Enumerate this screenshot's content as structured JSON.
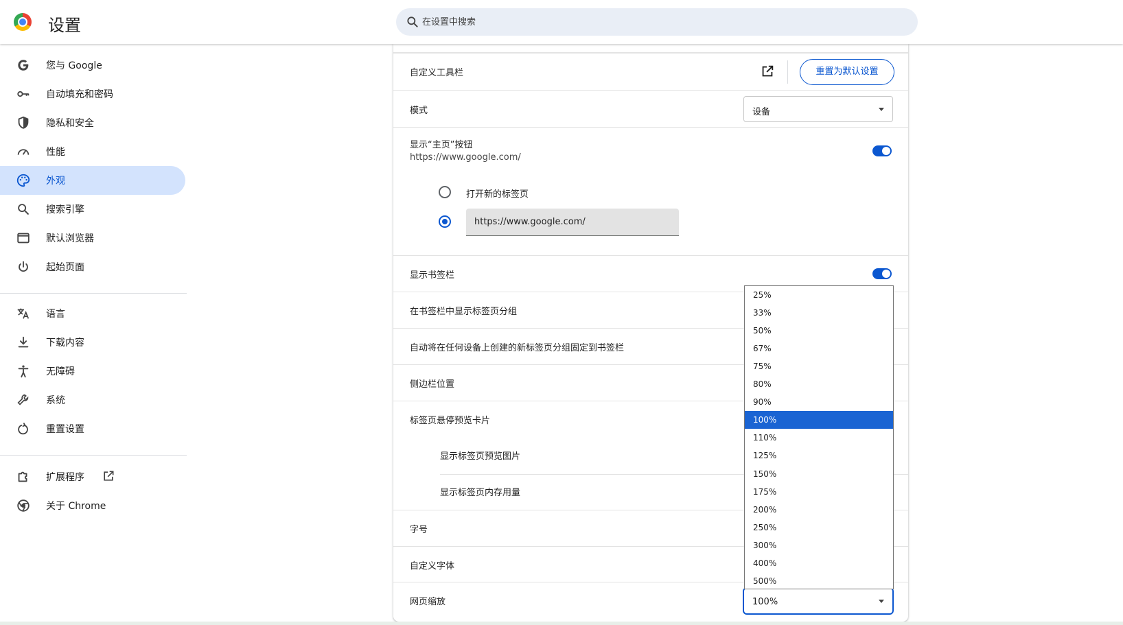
{
  "header": {
    "title": "设置",
    "search_placeholder": "在设置中搜索"
  },
  "sidebar": {
    "items": [
      {
        "label": "您与 Google",
        "icon": "google-g-icon"
      },
      {
        "label": "自动填充和密码",
        "icon": "key-icon"
      },
      {
        "label": "隐私和安全",
        "icon": "shield-icon"
      },
      {
        "label": "性能",
        "icon": "speedometer-icon"
      },
      {
        "label": "外观",
        "icon": "palette-icon",
        "active": true
      },
      {
        "label": "搜索引擎",
        "icon": "search-icon"
      },
      {
        "label": "默认浏览器",
        "icon": "browser-window-icon"
      },
      {
        "label": "起始页面",
        "icon": "power-icon"
      },
      {
        "label": "语言",
        "icon": "translate-icon"
      },
      {
        "label": "下载内容",
        "icon": "download-icon"
      },
      {
        "label": "无障碍",
        "icon": "accessibility-icon"
      },
      {
        "label": "系统",
        "icon": "wrench-icon"
      },
      {
        "label": "重置设置",
        "icon": "reset-icon"
      },
      {
        "label": "扩展程序",
        "icon": "puzzle-icon"
      },
      {
        "label": "关于 Chrome",
        "icon": "chrome-icon"
      }
    ]
  },
  "appearance": {
    "customize_toolbar": "自定义工具栏",
    "reset_button": "重置为默认设置",
    "mode_label": "模式",
    "mode_value": "设备",
    "home_button_label": "显示“主页”按钮",
    "home_button_sub": "https://www.google.com/",
    "home_button_on": true,
    "radio_new_tab": "打开新的标签页",
    "custom_url_value": "https://www.google.com/",
    "bookmarks_bar_label": "显示书签栏",
    "bookmarks_bar_on": true,
    "tab_groups_in_bookmarks": "在书签栏中显示标签页分组",
    "auto_pin_tab_groups": "自动将在任何设备上创建的新标签页分组固定到书签栏",
    "side_panel_position": "侧边栏位置",
    "tab_hover_card": "标签页悬停预览卡片",
    "show_tab_preview_image": "显示标签页预览图片",
    "show_tab_memory": "显示标签页内存用量",
    "font_size": "字号",
    "custom_fonts": "自定义字体",
    "page_zoom": "网页缩放",
    "page_zoom_value": "100%"
  },
  "zoom_options": [
    "25%",
    "33%",
    "50%",
    "67%",
    "75%",
    "80%",
    "90%",
    "100%",
    "110%",
    "125%",
    "150%",
    "175%",
    "200%",
    "250%",
    "300%",
    "400%",
    "500%"
  ],
  "zoom_selected": "100%",
  "colors": {
    "accent": "#0b57d0",
    "active_nav_bg": "#d3e3fd",
    "selected_option_bg": "#1a64d3"
  }
}
